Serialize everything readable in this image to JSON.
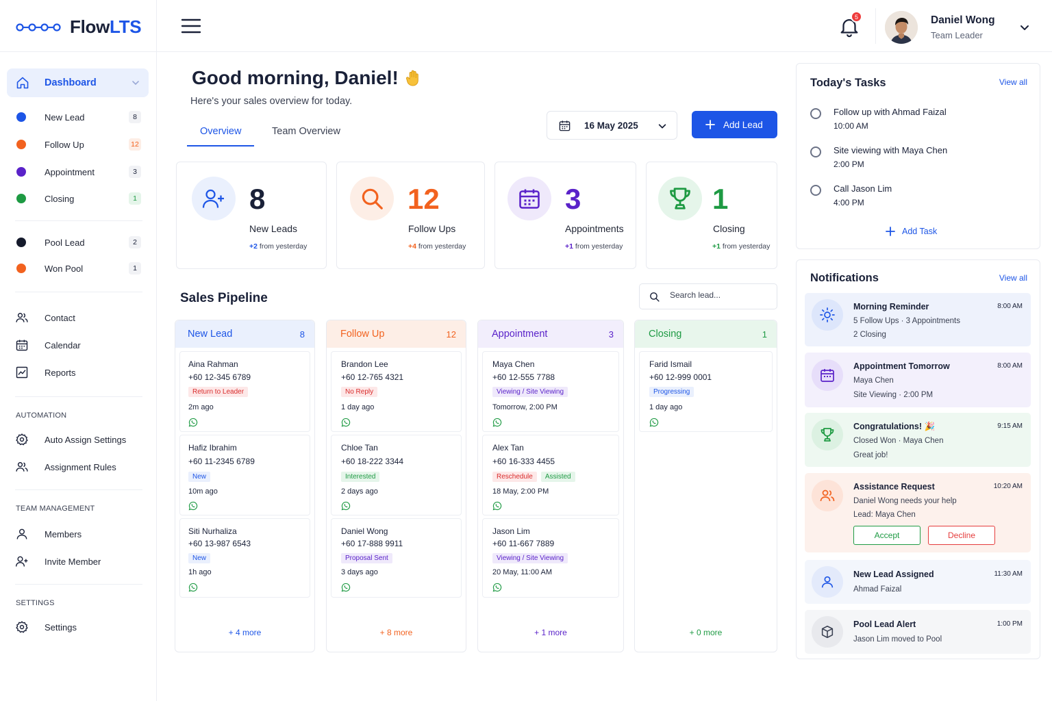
{
  "brand": {
    "name_prefix": "Flow",
    "name_accent": "LTS"
  },
  "header": {
    "notification_count": "5",
    "user": {
      "name": "Daniel Wong",
      "role": "Team Leader"
    }
  },
  "sidebar": {
    "active": {
      "label": "Dashboard"
    },
    "stages": [
      {
        "label": "New Lead",
        "count": "8",
        "color": "#1d55e6"
      },
      {
        "label": "Follow Up",
        "count": "12",
        "color": "#f2621f"
      },
      {
        "label": "Appointment",
        "count": "3",
        "color": "#5a22c9"
      },
      {
        "label": "Closing",
        "count": "1",
        "color": "#1e9a43"
      }
    ],
    "pools": [
      {
        "label": "Pool Lead",
        "count": "2",
        "color": "#151a2c"
      },
      {
        "label": "Won Pool",
        "count": "1",
        "color": "#f2621f"
      }
    ],
    "menu": [
      {
        "label": "Contact",
        "icon": "contacts-icon"
      },
      {
        "label": "Calendar",
        "icon": "calendar-icon"
      },
      {
        "label": "Reports",
        "icon": "reports-icon"
      }
    ],
    "automation": {
      "title": "AUTOMATION",
      "items": [
        {
          "label": "Auto Assign Settings"
        },
        {
          "label": "Assignment Rules"
        }
      ]
    },
    "team": {
      "title": "TEAM MANAGEMENT",
      "items": [
        {
          "label": "Members"
        },
        {
          "label": "Invite Member"
        }
      ]
    },
    "settings": {
      "title": "SETTINGS",
      "items": [
        {
          "label": "Settings"
        }
      ]
    }
  },
  "main": {
    "greeting": "Good morning, Daniel!",
    "subtitle": "Here's your sales overview for today.",
    "tabs": [
      {
        "label": "Overview",
        "active": true
      },
      {
        "label": "Team Overview",
        "active": false
      }
    ],
    "date": "16 May 2025",
    "add_lead": "Add Lead",
    "stats": [
      {
        "value": "8",
        "title": "New Leads",
        "delta": "+2",
        "delta_text": "from yesterday",
        "color": "#1d55e6"
      },
      {
        "value": "12",
        "title": "Follow Ups",
        "delta": "+4",
        "delta_text": "from yesterday",
        "color": "#f2621f"
      },
      {
        "value": "3",
        "title": "Appointments",
        "delta": "+1",
        "delta_text": "from yesterday",
        "color": "#5a22c9"
      },
      {
        "value": "1",
        "title": "Closing",
        "delta": "+1",
        "delta_text": "from yesterday",
        "color": "#1e9a43"
      }
    ],
    "pipeline": {
      "title": "Sales Pipeline",
      "search_placeholder": "Search lead...",
      "columns": [
        {
          "name": "New Lead",
          "count": "8",
          "more": "+ 4 more",
          "leads": [
            {
              "name": "Aina Rahman",
              "phone": "+60 12-345 6789",
              "tags": [
                "Return to Leader"
              ],
              "time": "2m ago"
            },
            {
              "name": "Hafiz Ibrahim",
              "phone": "+60 11-2345 6789",
              "tags": [
                "New"
              ],
              "time": "10m ago"
            },
            {
              "name": "Siti Nurhaliza",
              "phone": "+60 13-987 6543",
              "tags": [
                "New"
              ],
              "time": "1h ago"
            }
          ]
        },
        {
          "name": "Follow Up",
          "count": "12",
          "more": "+ 8 more",
          "leads": [
            {
              "name": "Brandon Lee",
              "phone": "+60 12-765 4321",
              "tags": [
                "No Reply"
              ],
              "time": "1 day ago"
            },
            {
              "name": "Chloe Tan",
              "phone": "+60 18-222 3344",
              "tags": [
                "Interested"
              ],
              "time": "2 days ago"
            },
            {
              "name": "Daniel Wong",
              "phone": "+60 17-888 9911",
              "tags": [
                "Proposal Sent"
              ],
              "time": "3 days ago"
            }
          ]
        },
        {
          "name": "Appointment",
          "count": "3",
          "more": "+ 1 more",
          "leads": [
            {
              "name": "Maya Chen",
              "phone": "+60 12-555 7788",
              "tags": [
                "Viewing / Site Viewing"
              ],
              "time": "Tomorrow, 2:00 PM"
            },
            {
              "name": "Alex Tan",
              "phone": "+60 16-333 4455",
              "tags": [
                "Reschedule",
                "Assisted"
              ],
              "time": "18 May, 2:00 PM"
            },
            {
              "name": "Jason Lim",
              "phone": "+60 11-667 7889",
              "tags": [
                "Viewing / Site Viewing"
              ],
              "time": "20 May, 11:00 AM"
            }
          ]
        },
        {
          "name": "Closing",
          "count": "1",
          "more": "+ 0 more",
          "leads": [
            {
              "name": "Farid Ismail",
              "phone": "+60 12-999 0001",
              "tags": [
                "Progressing"
              ],
              "time": "1 day ago"
            }
          ]
        }
      ]
    }
  },
  "tasks": {
    "title": "Today's Tasks",
    "view_all": "View all",
    "add_task": "Add Task",
    "items": [
      {
        "title": "Follow up with Ahmad Faizal",
        "time": "10:00 AM"
      },
      {
        "title": "Site viewing with Maya Chen",
        "time": "2:00 PM"
      },
      {
        "title": "Call Jason Lim",
        "time": "4:00 PM"
      }
    ]
  },
  "notifications": {
    "title": "Notifications",
    "view_all": "View all",
    "items": [
      {
        "title": "Morning Reminder",
        "time": "8:00 AM",
        "line1": "5 Follow Ups · 3 Appointments",
        "line2": "2 Closing"
      },
      {
        "title": "Appointment Tomorrow",
        "time": "8:00 AM",
        "line1": "Maya Chen",
        "line2": "Site Viewing · 2:00 PM"
      },
      {
        "title": "Congratulations! 🎉",
        "time": "9:15 AM",
        "line1": "Closed Won · Maya Chen",
        "line2": "Great job!"
      },
      {
        "title": "Assistance Request",
        "time": "10:20 AM",
        "line1": "Daniel Wong needs your help",
        "line2": "Lead: Maya Chen",
        "accept": "Accept",
        "decline": "Decline"
      },
      {
        "title": "New Lead Assigned",
        "time": "11:30 AM",
        "line1": "Ahmad Faizal"
      },
      {
        "title": "Pool Lead Alert",
        "time": "1:00 PM",
        "line1": "Jason Lim moved to Pool"
      }
    ]
  }
}
